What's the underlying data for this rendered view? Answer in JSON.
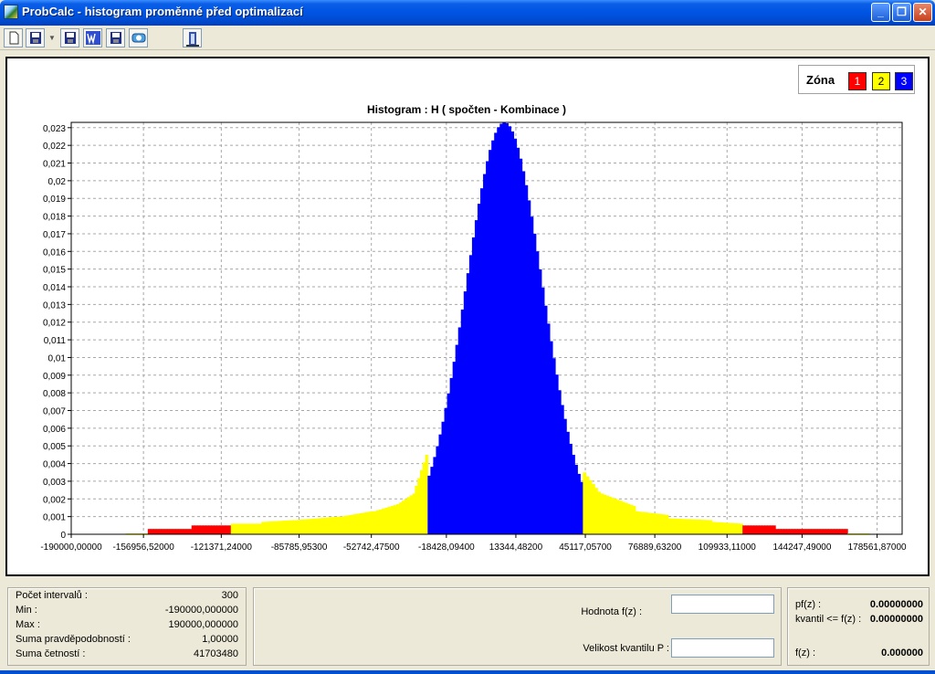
{
  "window": {
    "title": "ProbCalc - histogram proměnné před optimalizací",
    "controls": {
      "minimize": "_",
      "maximize": "❐",
      "close": "✕"
    }
  },
  "toolbar": {
    "buttons": [
      {
        "name": "new-icon"
      },
      {
        "name": "save-icon"
      },
      {
        "name": "save-as-icon"
      },
      {
        "name": "word-export-icon"
      },
      {
        "name": "floppy-icon"
      },
      {
        "name": "image-export-icon"
      },
      {
        "name": "exit-icon"
      }
    ]
  },
  "legend": {
    "label": "Zóna",
    "zones": [
      {
        "label": "1",
        "color": "#ff0000"
      },
      {
        "label": "2",
        "color": "#ffff00"
      },
      {
        "label": "3",
        "color": "#0000ff"
      }
    ]
  },
  "chart_data": {
    "type": "bar",
    "title": "Histogram : H ( spočten - Kombinace )",
    "xlim": [
      -190000,
      190000
    ],
    "ylim": [
      0,
      0.0233
    ],
    "grid": true,
    "yticks": [
      "0",
      "0,001",
      "0,002",
      "0,003",
      "0,004",
      "0,005",
      "0,006",
      "0,007",
      "0,008",
      "0,009",
      "0,01",
      "0,011",
      "0,012",
      "0,013",
      "0,014",
      "0,015",
      "0,016",
      "0,017",
      "0,018",
      "0,019",
      "0,02",
      "0,021",
      "0,022",
      "0,023"
    ],
    "xticks": [
      "-190000,00000",
      "-156956,52000",
      "-121371,24000",
      "-85785,95300",
      "-52742,47500",
      "-18428,09400",
      "13344,48200",
      "45117,05700",
      "76889,63200",
      "109933,11000",
      "144247,49000",
      "178561,87000"
    ],
    "zone_colors": {
      "1": "#ff0000",
      "2": "#ffff00",
      "3": "#0000ff"
    },
    "zones": [
      {
        "zone": "2",
        "x": [
          -165000,
          -155000
        ],
        "y": [
          5e-05,
          5e-05
        ]
      },
      {
        "zone": "1",
        "x": [
          -155000,
          -135000
        ],
        "y": [
          0.0003,
          0.0003
        ]
      },
      {
        "zone": "1",
        "x": [
          -135000,
          -117000
        ],
        "y": [
          0.0005,
          0.0005
        ]
      },
      {
        "zone": "2",
        "x": [
          -117000,
          -103000
        ],
        "y": [
          0.0006,
          0.0006
        ]
      },
      {
        "zone": "2",
        "x": [
          -103000,
          -88000
        ],
        "y": [
          0.0007,
          0.0008
        ]
      },
      {
        "zone": "2",
        "x": [
          -88000,
          -67000
        ],
        "y": [
          0.0008,
          0.001
        ]
      },
      {
        "zone": "2",
        "x": [
          -67000,
          -52000
        ],
        "y": [
          0.001,
          0.0013
        ]
      },
      {
        "zone": "2",
        "x": [
          -52000,
          -40000
        ],
        "y": [
          0.0013,
          0.0017
        ]
      },
      {
        "zone": "2",
        "x": [
          -40000,
          -34000
        ],
        "y": [
          0.0018,
          0.0022
        ]
      },
      {
        "zone": "2",
        "x": [
          -34000,
          -27000
        ],
        "y": [
          0.0023,
          0.0045
        ]
      },
      {
        "zone": "3",
        "x": [
          -27000,
          44000
        ],
        "peak_x": 8000,
        "sigma": 17400,
        "peak": 0.0233
      },
      {
        "zone": "2",
        "x": [
          44000,
          52000
        ],
        "y": [
          0.0035,
          0.0024
        ]
      },
      {
        "zone": "2",
        "x": [
          52000,
          68000
        ],
        "y": [
          0.0023,
          0.0016
        ]
      },
      {
        "zone": "2",
        "x": [
          68000,
          83000
        ],
        "y": [
          0.0013,
          0.0011
        ]
      },
      {
        "zone": "2",
        "x": [
          83000,
          103000
        ],
        "y": [
          0.0009,
          0.0008
        ]
      },
      {
        "zone": "2",
        "x": [
          103000,
          117000
        ],
        "y": [
          0.0007,
          0.0006
        ]
      },
      {
        "zone": "1",
        "x": [
          117000,
          132000
        ],
        "y": [
          0.0005,
          0.0005
        ]
      },
      {
        "zone": "1",
        "x": [
          132000,
          165000
        ],
        "y": [
          0.0003,
          0.0003
        ]
      },
      {
        "zone": "2",
        "x": [
          165000,
          175000
        ],
        "y": [
          5e-05,
          5e-05
        ]
      }
    ]
  },
  "stats": {
    "rows": [
      {
        "label": "Počet intervalů :",
        "value": "300"
      },
      {
        "label": "Min :",
        "value": "-190000,000000"
      },
      {
        "label": "Max :",
        "value": "190000,000000"
      },
      {
        "label": "Suma pravděpodobností :",
        "value": "1,00000"
      },
      {
        "label": "Suma četností :",
        "value": "41703480"
      }
    ]
  },
  "query": {
    "fz_label": "Hodnota f(z) :",
    "fz_value": "",
    "p_label": "Velikost kvantilu P :",
    "p_value": ""
  },
  "results": {
    "pf_label": "pf(z) :",
    "pf_value": "0.00000000",
    "kvantil_label": "kvantil <= f(z) :",
    "kvantil_value": "0.00000000",
    "fz_label": "f(z) :",
    "fz_value": "0.000000"
  }
}
